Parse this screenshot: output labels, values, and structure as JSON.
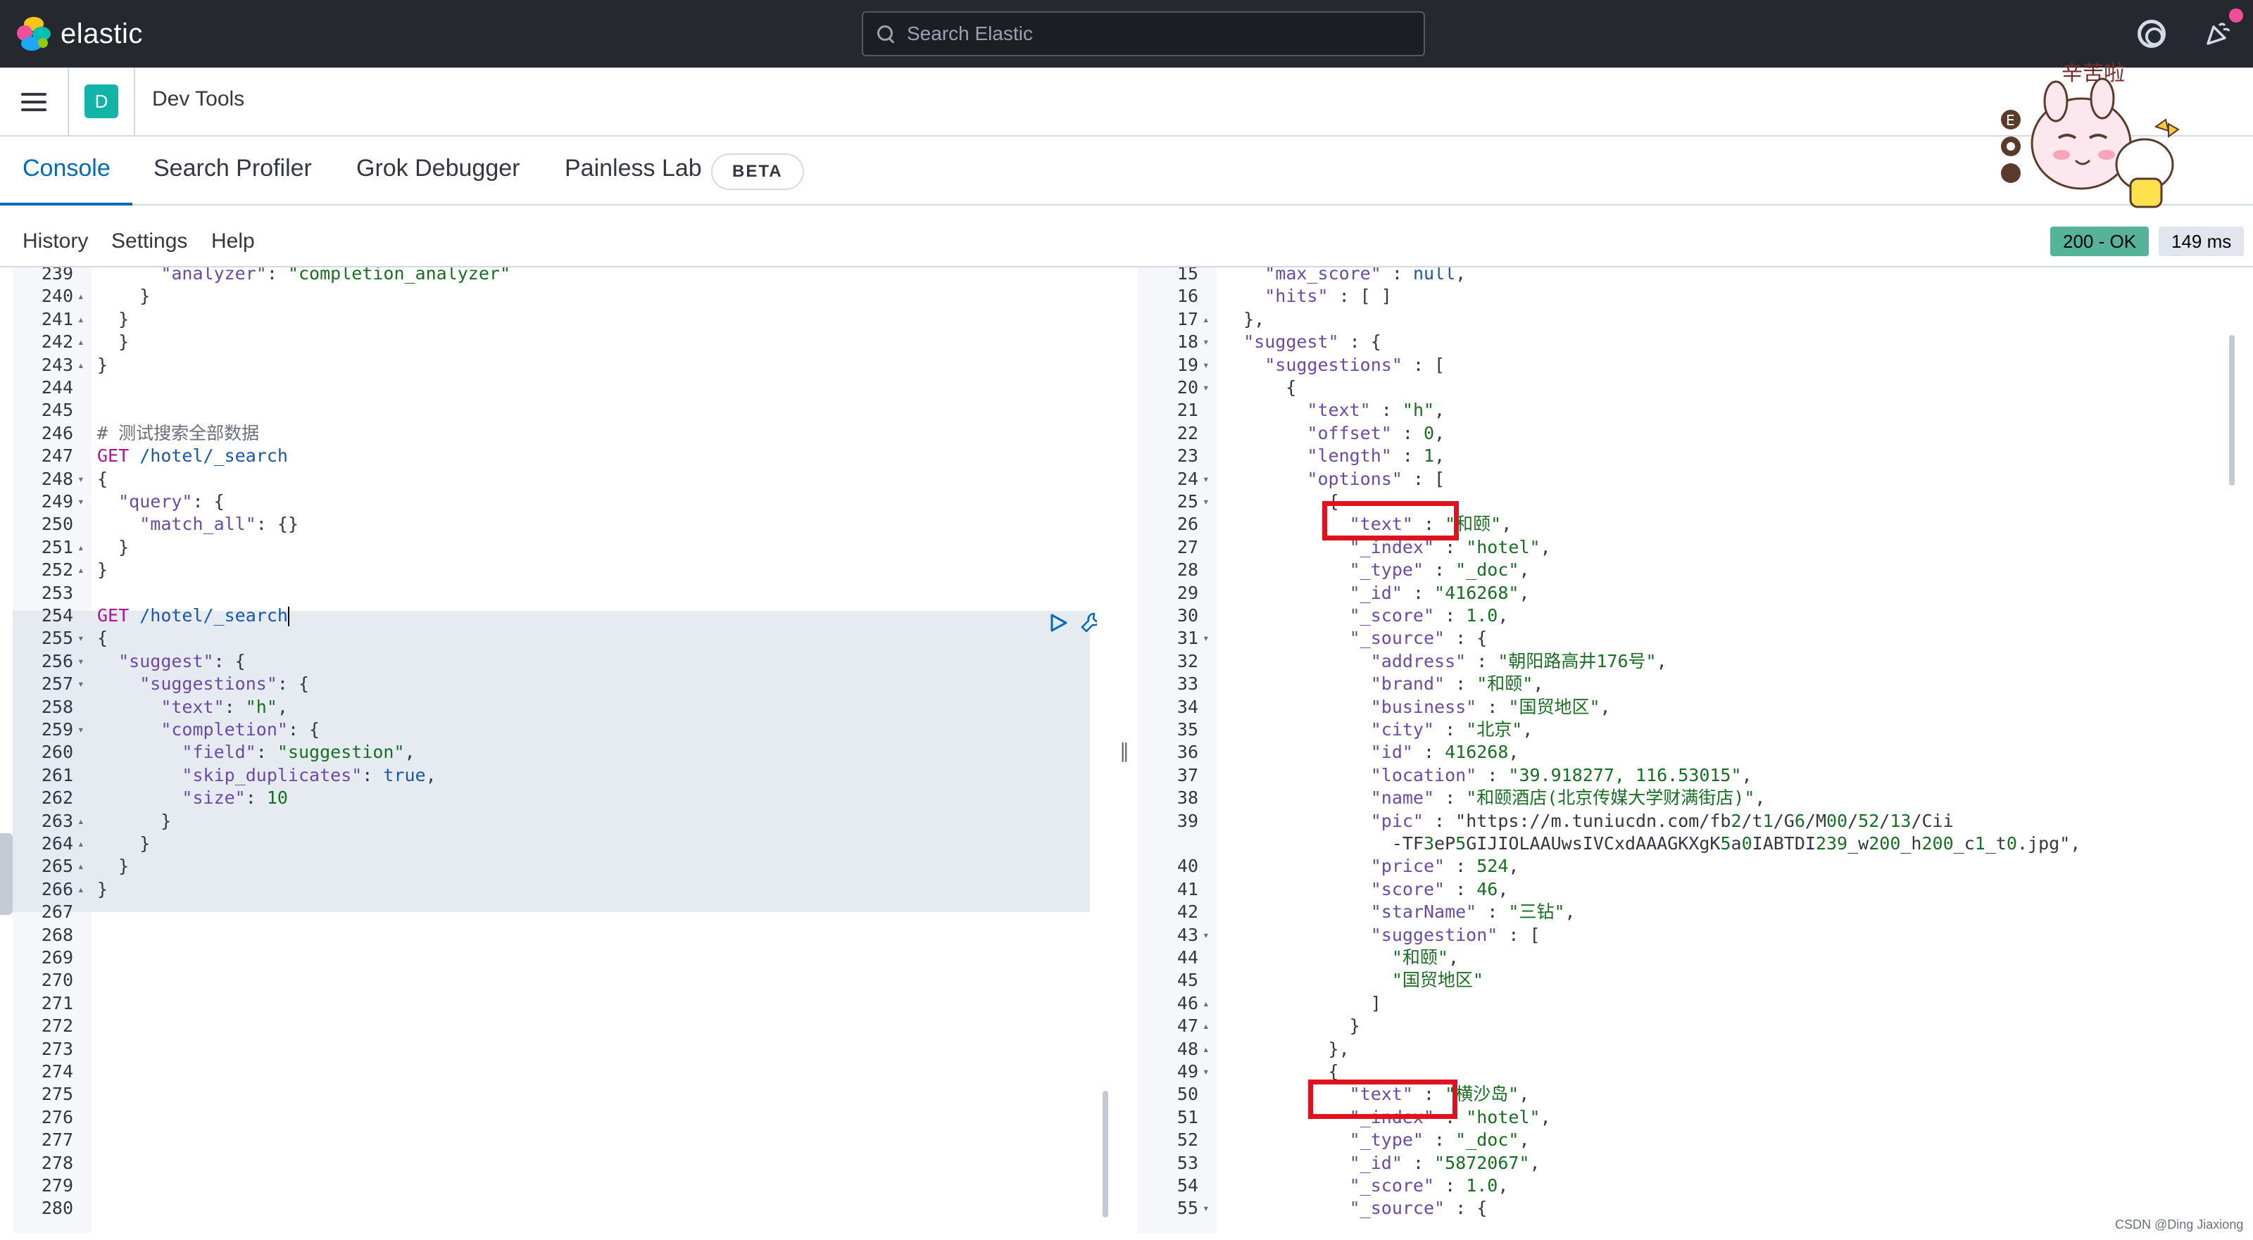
{
  "header": {
    "brand": "elastic",
    "search_placeholder": "Search Elastic"
  },
  "appbar": {
    "space_initial": "D",
    "breadcrumb": "Dev Tools"
  },
  "tabs": [
    {
      "label": "Console",
      "active": true
    },
    {
      "label": "Search Profiler",
      "active": false
    },
    {
      "label": "Grok Debugger",
      "active": false
    },
    {
      "label": "Painless Lab",
      "active": false
    }
  ],
  "beta_badge": "BETA",
  "console_toolbar": {
    "history": "History",
    "settings": "Settings",
    "help": "Help",
    "status": "200 - OK",
    "time": "149 ms"
  },
  "sticker": {
    "text": "辛苦啦"
  },
  "colors": {
    "accent": "#006bb8",
    "status_ok": "#54b399",
    "highlight": "#e0121f",
    "header_bg": "#25282f"
  },
  "request_lines": [
    {
      "n": "239",
      "f": "",
      "t": "      \"analyzer\": \"completion_analyzer\""
    },
    {
      "n": "240",
      "f": "▴",
      "t": "    }"
    },
    {
      "n": "241",
      "f": "▴",
      "t": "  }"
    },
    {
      "n": "242",
      "f": "▴",
      "t": "  }"
    },
    {
      "n": "243",
      "f": "▴",
      "t": "}"
    },
    {
      "n": "244",
      "f": "",
      "t": ""
    },
    {
      "n": "245",
      "f": "",
      "t": ""
    },
    {
      "n": "246",
      "f": "",
      "t": "# 测试搜索全部数据"
    },
    {
      "n": "247",
      "f": "",
      "t": "GET /hotel/_search"
    },
    {
      "n": "248",
      "f": "▾",
      "t": "{"
    },
    {
      "n": "249",
      "f": "▾",
      "t": "  \"query\": {"
    },
    {
      "n": "250",
      "f": "",
      "t": "    \"match_all\": {}"
    },
    {
      "n": "251",
      "f": "▴",
      "t": "  }"
    },
    {
      "n": "252",
      "f": "▴",
      "t": "}"
    },
    {
      "n": "253",
      "f": "",
      "t": ""
    },
    {
      "n": "254",
      "f": "",
      "t": "GET /hotel/_search"
    },
    {
      "n": "255",
      "f": "▾",
      "t": "{"
    },
    {
      "n": "256",
      "f": "▾",
      "t": "  \"suggest\": {"
    },
    {
      "n": "257",
      "f": "▾",
      "t": "    \"suggestions\": {"
    },
    {
      "n": "258",
      "f": "",
      "t": "      \"text\": \"h\","
    },
    {
      "n": "259",
      "f": "▾",
      "t": "      \"completion\": {"
    },
    {
      "n": "260",
      "f": "",
      "t": "        \"field\": \"suggestion\","
    },
    {
      "n": "261",
      "f": "",
      "t": "        \"skip_duplicates\": true,"
    },
    {
      "n": "262",
      "f": "",
      "t": "        \"size\": 10"
    },
    {
      "n": "263",
      "f": "▴",
      "t": "      }"
    },
    {
      "n": "264",
      "f": "▴",
      "t": "    }"
    },
    {
      "n": "265",
      "f": "▴",
      "t": "  }"
    },
    {
      "n": "266",
      "f": "▴",
      "t": "}"
    },
    {
      "n": "267",
      "f": "",
      "t": ""
    },
    {
      "n": "268",
      "f": "",
      "t": ""
    },
    {
      "n": "269",
      "f": "",
      "t": ""
    },
    {
      "n": "270",
      "f": "",
      "t": ""
    },
    {
      "n": "271",
      "f": "",
      "t": ""
    },
    {
      "n": "272",
      "f": "",
      "t": ""
    },
    {
      "n": "273",
      "f": "",
      "t": ""
    },
    {
      "n": "274",
      "f": "",
      "t": ""
    },
    {
      "n": "275",
      "f": "",
      "t": ""
    },
    {
      "n": "276",
      "f": "",
      "t": ""
    },
    {
      "n": "277",
      "f": "",
      "t": ""
    },
    {
      "n": "278",
      "f": "",
      "t": ""
    },
    {
      "n": "279",
      "f": "",
      "t": ""
    },
    {
      "n": "280",
      "f": "",
      "t": ""
    }
  ],
  "response_lines": [
    {
      "n": "15",
      "f": "",
      "t": "    \"max_score\" : null,"
    },
    {
      "n": "16",
      "f": "",
      "t": "    \"hits\" : [ ]"
    },
    {
      "n": "17",
      "f": "▴",
      "t": "  },"
    },
    {
      "n": "18",
      "f": "▾",
      "t": "  \"suggest\" : {"
    },
    {
      "n": "19",
      "f": "▾",
      "t": "    \"suggestions\" : ["
    },
    {
      "n": "20",
      "f": "▾",
      "t": "      {"
    },
    {
      "n": "21",
      "f": "",
      "t": "        \"text\" : \"h\","
    },
    {
      "n": "22",
      "f": "",
      "t": "        \"offset\" : 0,"
    },
    {
      "n": "23",
      "f": "",
      "t": "        \"length\" : 1,"
    },
    {
      "n": "24",
      "f": "▾",
      "t": "        \"options\" : ["
    },
    {
      "n": "25",
      "f": "▾",
      "t": "          {"
    },
    {
      "n": "26",
      "f": "",
      "t": "            \"text\" : \"和颐\","
    },
    {
      "n": "27",
      "f": "",
      "t": "            \"_index\" : \"hotel\","
    },
    {
      "n": "28",
      "f": "",
      "t": "            \"_type\" : \"_doc\","
    },
    {
      "n": "29",
      "f": "",
      "t": "            \"_id\" : \"416268\","
    },
    {
      "n": "30",
      "f": "",
      "t": "            \"_score\" : 1.0,"
    },
    {
      "n": "31",
      "f": "▾",
      "t": "            \"_source\" : {"
    },
    {
      "n": "32",
      "f": "",
      "t": "              \"address\" : \"朝阳路高井176号\","
    },
    {
      "n": "33",
      "f": "",
      "t": "              \"brand\" : \"和颐\","
    },
    {
      "n": "34",
      "f": "",
      "t": "              \"business\" : \"国贸地区\","
    },
    {
      "n": "35",
      "f": "",
      "t": "              \"city\" : \"北京\","
    },
    {
      "n": "36",
      "f": "",
      "t": "              \"id\" : 416268,"
    },
    {
      "n": "37",
      "f": "",
      "t": "              \"location\" : \"39.918277, 116.53015\","
    },
    {
      "n": "38",
      "f": "",
      "t": "              \"name\" : \"和颐酒店(北京传媒大学财满街店)\","
    },
    {
      "n": "39",
      "f": "",
      "t": "              \"pic\" : \"https://m.tuniucdn.com/fb2/t1/G6/M00/52/13/Cii"
    },
    {
      "n": "",
      "f": "",
      "t": "                -TF3eP5GIJIOLAAUwsIVCxdAAAGKXgK5a0IABTDI239_w200_h200_c1_t0.jpg\","
    },
    {
      "n": "40",
      "f": "",
      "t": "              \"price\" : 524,"
    },
    {
      "n": "41",
      "f": "",
      "t": "              \"score\" : 46,"
    },
    {
      "n": "42",
      "f": "",
      "t": "              \"starName\" : \"三钻\","
    },
    {
      "n": "43",
      "f": "▾",
      "t": "              \"suggestion\" : ["
    },
    {
      "n": "44",
      "f": "",
      "t": "                \"和颐\","
    },
    {
      "n": "45",
      "f": "",
      "t": "                \"国贸地区\""
    },
    {
      "n": "46",
      "f": "▴",
      "t": "              ]"
    },
    {
      "n": "47",
      "f": "▴",
      "t": "            }"
    },
    {
      "n": "48",
      "f": "▴",
      "t": "          },"
    },
    {
      "n": "49",
      "f": "▾",
      "t": "          {"
    },
    {
      "n": "50",
      "f": "",
      "t": "            \"text\" : \"横沙岛\","
    },
    {
      "n": "51",
      "f": "",
      "t": "            \"_index\" : \"hotel\","
    },
    {
      "n": "52",
      "f": "",
      "t": "            \"_type\" : \"_doc\","
    },
    {
      "n": "53",
      "f": "",
      "t": "            \"_id\" : \"5872067\","
    },
    {
      "n": "54",
      "f": "",
      "t": "            \"_score\" : 1.0,"
    },
    {
      "n": "55",
      "f": "▾",
      "t": "            \"_source\" : {"
    }
  ],
  "watermark": "CSDN @Ding Jiaxiong"
}
